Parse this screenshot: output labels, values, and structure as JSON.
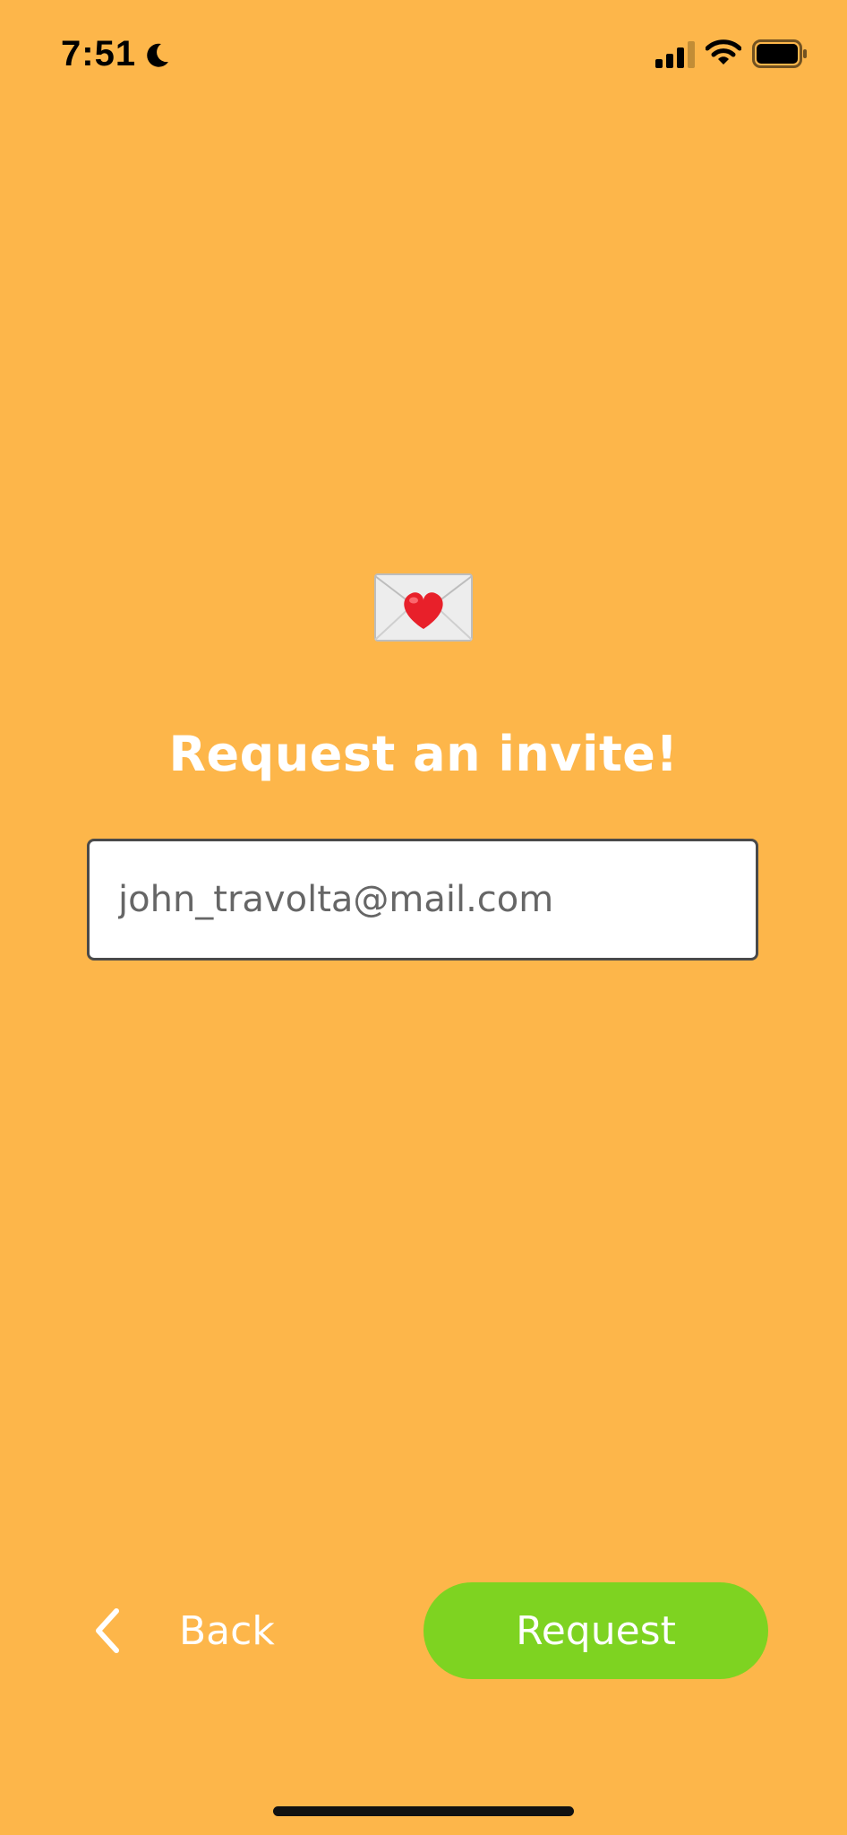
{
  "status_bar": {
    "time": "7:51",
    "icons": [
      "moon-icon",
      "cellular-signal-icon",
      "wifi-icon",
      "battery-icon"
    ]
  },
  "main": {
    "icon": "love-letter-icon",
    "title": "Request an invite!",
    "email_input": {
      "placeholder": "john_travolta@mail.com",
      "value": ""
    }
  },
  "footer": {
    "back_label": "Back",
    "request_label": "Request"
  },
  "colors": {
    "background": "#FDB64A",
    "request_button": "#7ED321",
    "text_light": "#FFFFFF"
  }
}
